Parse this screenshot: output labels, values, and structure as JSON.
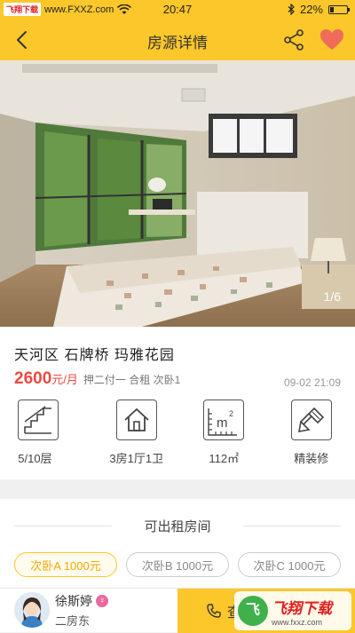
{
  "status": {
    "watermark": "飞翔下载",
    "site": "www.FXXZ.com",
    "time": "20:47",
    "battery": "22%"
  },
  "nav": {
    "title": "房源详情",
    "back_icon": "chevron-left-icon",
    "share_icon": "share-icon",
    "favorite_icon": "heart-icon"
  },
  "photo": {
    "counter": "1/6"
  },
  "listing": {
    "address": "天河区 石牌桥 玛雅花园",
    "price": "2600",
    "price_unit": "元/月",
    "terms": "押二付一 合租 次卧1",
    "date": "09-02 21:09",
    "features": [
      {
        "icon": "stairs-icon",
        "label": "5/10层"
      },
      {
        "icon": "house-icon",
        "label": "3房1厅1卫"
      },
      {
        "icon": "area-icon",
        "label": "112㎡"
      },
      {
        "icon": "decoration-brush-icon",
        "label": "精装修"
      }
    ]
  },
  "rooms": {
    "heading": "可出租房间",
    "items": [
      {
        "label": "次卧A 1000元",
        "active": true
      },
      {
        "label": "次卧B 1000元",
        "active": false
      },
      {
        "label": "次卧C 1000元",
        "active": false
      }
    ]
  },
  "agent": {
    "name": "徐斯婷",
    "role": "二房东",
    "gender_icon": "female-icon"
  },
  "call": {
    "label": "查"
  },
  "corner_logo": {
    "text": "飞翔下载",
    "site": "www.fxxz.com"
  },
  "colors": {
    "accent": "#fcc72a",
    "price": "#e94b42",
    "favorite": "#f06b5a"
  }
}
